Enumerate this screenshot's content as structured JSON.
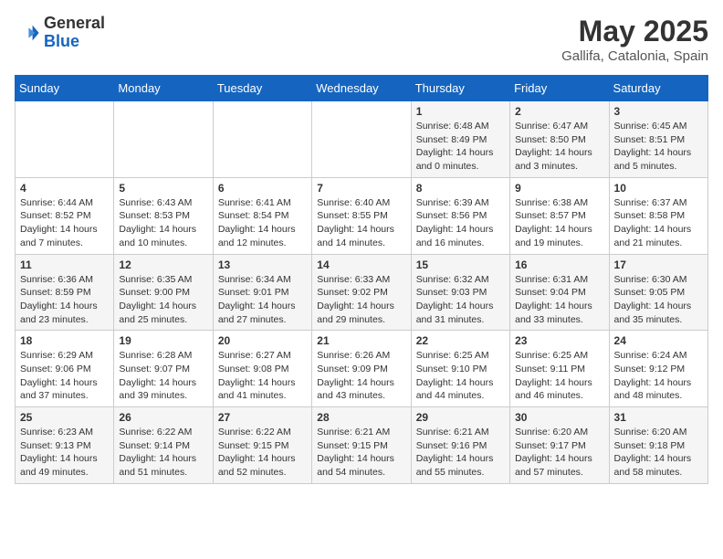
{
  "header": {
    "logo_general": "General",
    "logo_blue": "Blue",
    "month": "May 2025",
    "location": "Gallifa, Catalonia, Spain"
  },
  "weekdays": [
    "Sunday",
    "Monday",
    "Tuesday",
    "Wednesday",
    "Thursday",
    "Friday",
    "Saturday"
  ],
  "weeks": [
    [
      {
        "day": "",
        "info": ""
      },
      {
        "day": "",
        "info": ""
      },
      {
        "day": "",
        "info": ""
      },
      {
        "day": "",
        "info": ""
      },
      {
        "day": "1",
        "info": "Sunrise: 6:48 AM\nSunset: 8:49 PM\nDaylight: 14 hours and 0 minutes."
      },
      {
        "day": "2",
        "info": "Sunrise: 6:47 AM\nSunset: 8:50 PM\nDaylight: 14 hours and 3 minutes."
      },
      {
        "day": "3",
        "info": "Sunrise: 6:45 AM\nSunset: 8:51 PM\nDaylight: 14 hours and 5 minutes."
      }
    ],
    [
      {
        "day": "4",
        "info": "Sunrise: 6:44 AM\nSunset: 8:52 PM\nDaylight: 14 hours and 7 minutes."
      },
      {
        "day": "5",
        "info": "Sunrise: 6:43 AM\nSunset: 8:53 PM\nDaylight: 14 hours and 10 minutes."
      },
      {
        "day": "6",
        "info": "Sunrise: 6:41 AM\nSunset: 8:54 PM\nDaylight: 14 hours and 12 minutes."
      },
      {
        "day": "7",
        "info": "Sunrise: 6:40 AM\nSunset: 8:55 PM\nDaylight: 14 hours and 14 minutes."
      },
      {
        "day": "8",
        "info": "Sunrise: 6:39 AM\nSunset: 8:56 PM\nDaylight: 14 hours and 16 minutes."
      },
      {
        "day": "9",
        "info": "Sunrise: 6:38 AM\nSunset: 8:57 PM\nDaylight: 14 hours and 19 minutes."
      },
      {
        "day": "10",
        "info": "Sunrise: 6:37 AM\nSunset: 8:58 PM\nDaylight: 14 hours and 21 minutes."
      }
    ],
    [
      {
        "day": "11",
        "info": "Sunrise: 6:36 AM\nSunset: 8:59 PM\nDaylight: 14 hours and 23 minutes."
      },
      {
        "day": "12",
        "info": "Sunrise: 6:35 AM\nSunset: 9:00 PM\nDaylight: 14 hours and 25 minutes."
      },
      {
        "day": "13",
        "info": "Sunrise: 6:34 AM\nSunset: 9:01 PM\nDaylight: 14 hours and 27 minutes."
      },
      {
        "day": "14",
        "info": "Sunrise: 6:33 AM\nSunset: 9:02 PM\nDaylight: 14 hours and 29 minutes."
      },
      {
        "day": "15",
        "info": "Sunrise: 6:32 AM\nSunset: 9:03 PM\nDaylight: 14 hours and 31 minutes."
      },
      {
        "day": "16",
        "info": "Sunrise: 6:31 AM\nSunset: 9:04 PM\nDaylight: 14 hours and 33 minutes."
      },
      {
        "day": "17",
        "info": "Sunrise: 6:30 AM\nSunset: 9:05 PM\nDaylight: 14 hours and 35 minutes."
      }
    ],
    [
      {
        "day": "18",
        "info": "Sunrise: 6:29 AM\nSunset: 9:06 PM\nDaylight: 14 hours and 37 minutes."
      },
      {
        "day": "19",
        "info": "Sunrise: 6:28 AM\nSunset: 9:07 PM\nDaylight: 14 hours and 39 minutes."
      },
      {
        "day": "20",
        "info": "Sunrise: 6:27 AM\nSunset: 9:08 PM\nDaylight: 14 hours and 41 minutes."
      },
      {
        "day": "21",
        "info": "Sunrise: 6:26 AM\nSunset: 9:09 PM\nDaylight: 14 hours and 43 minutes."
      },
      {
        "day": "22",
        "info": "Sunrise: 6:25 AM\nSunset: 9:10 PM\nDaylight: 14 hours and 44 minutes."
      },
      {
        "day": "23",
        "info": "Sunrise: 6:25 AM\nSunset: 9:11 PM\nDaylight: 14 hours and 46 minutes."
      },
      {
        "day": "24",
        "info": "Sunrise: 6:24 AM\nSunset: 9:12 PM\nDaylight: 14 hours and 48 minutes."
      }
    ],
    [
      {
        "day": "25",
        "info": "Sunrise: 6:23 AM\nSunset: 9:13 PM\nDaylight: 14 hours and 49 minutes."
      },
      {
        "day": "26",
        "info": "Sunrise: 6:22 AM\nSunset: 9:14 PM\nDaylight: 14 hours and 51 minutes."
      },
      {
        "day": "27",
        "info": "Sunrise: 6:22 AM\nSunset: 9:15 PM\nDaylight: 14 hours and 52 minutes."
      },
      {
        "day": "28",
        "info": "Sunrise: 6:21 AM\nSunset: 9:15 PM\nDaylight: 14 hours and 54 minutes."
      },
      {
        "day": "29",
        "info": "Sunrise: 6:21 AM\nSunset: 9:16 PM\nDaylight: 14 hours and 55 minutes."
      },
      {
        "day": "30",
        "info": "Sunrise: 6:20 AM\nSunset: 9:17 PM\nDaylight: 14 hours and 57 minutes."
      },
      {
        "day": "31",
        "info": "Sunrise: 6:20 AM\nSunset: 9:18 PM\nDaylight: 14 hours and 58 minutes."
      }
    ]
  ]
}
